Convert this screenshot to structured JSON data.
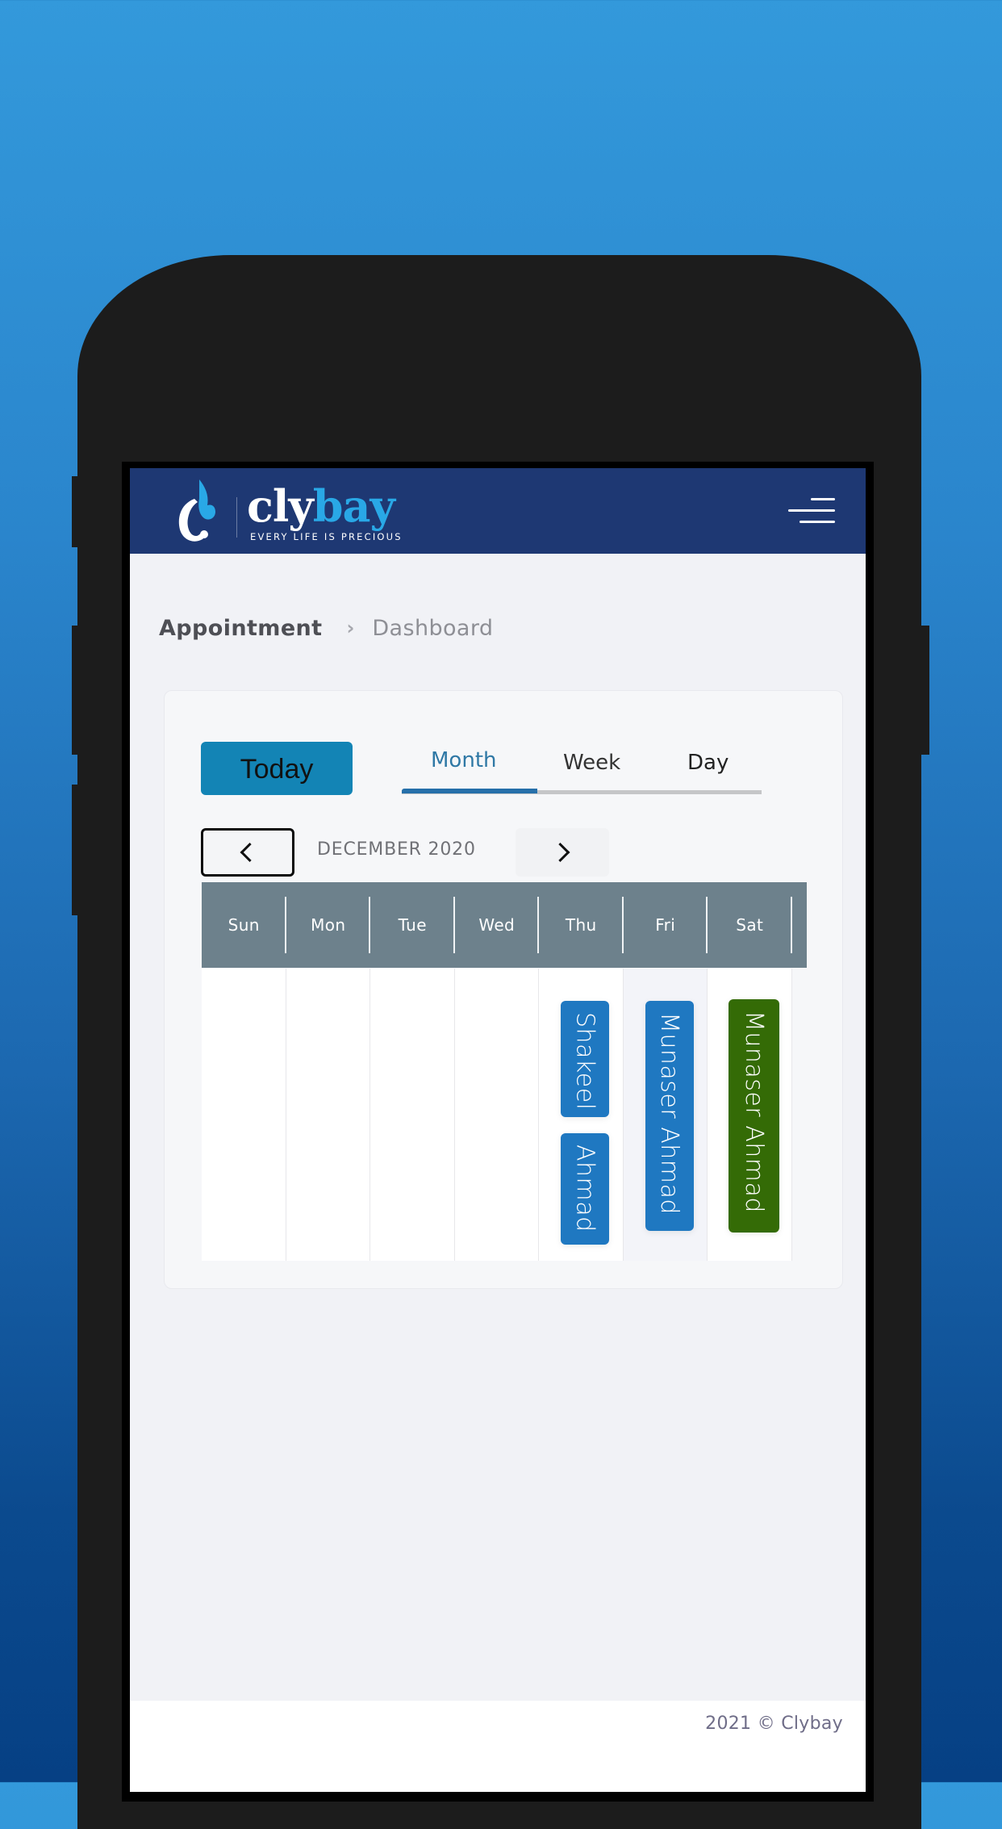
{
  "colors": {
    "background_top": "#3399db",
    "background_bottom": "#064084",
    "header": "#1e3873",
    "brand_light": "#29a8e6",
    "today_button": "#1384b5",
    "tab_active": "#2f78a5",
    "calendar_header": "#6d818c",
    "event_blue": "#1f78c1",
    "event_green": "#346b06"
  },
  "header": {
    "logo_icon": "clybay-logo-icon",
    "logo_text_dark": "cly",
    "logo_text_light": "bay",
    "tagline": "EVERY LIFE IS PRECIOUS",
    "menu_icon": "hamburger-menu-icon"
  },
  "breadcrumb": {
    "parent": "Appointment",
    "separator": "›",
    "current": "Dashboard"
  },
  "calendar": {
    "today_label": "Today",
    "views": [
      {
        "label": "Month",
        "active": true
      },
      {
        "label": "Week",
        "active": false
      },
      {
        "label": "Day",
        "active": false
      }
    ],
    "prev_icon": "chevron-left-icon",
    "next_icon": "chevron-right-icon",
    "month_label": "DECEMBER 2020",
    "weekdays": [
      "Sun",
      "Mon",
      "Tue",
      "Wed",
      "Thu",
      "Fri",
      "Sat"
    ],
    "events": [
      {
        "day": "Thu",
        "title": "Shakeel",
        "color": "blue"
      },
      {
        "day": "Thu",
        "title": "Ahmad",
        "color": "blue"
      },
      {
        "day": "Fri",
        "title": "Munaser Ahmad",
        "color": "blue"
      },
      {
        "day": "Sat",
        "title": "Munaser Ahmad",
        "color": "green"
      }
    ]
  },
  "footer": {
    "copyright": "2021 © Clybay"
  }
}
